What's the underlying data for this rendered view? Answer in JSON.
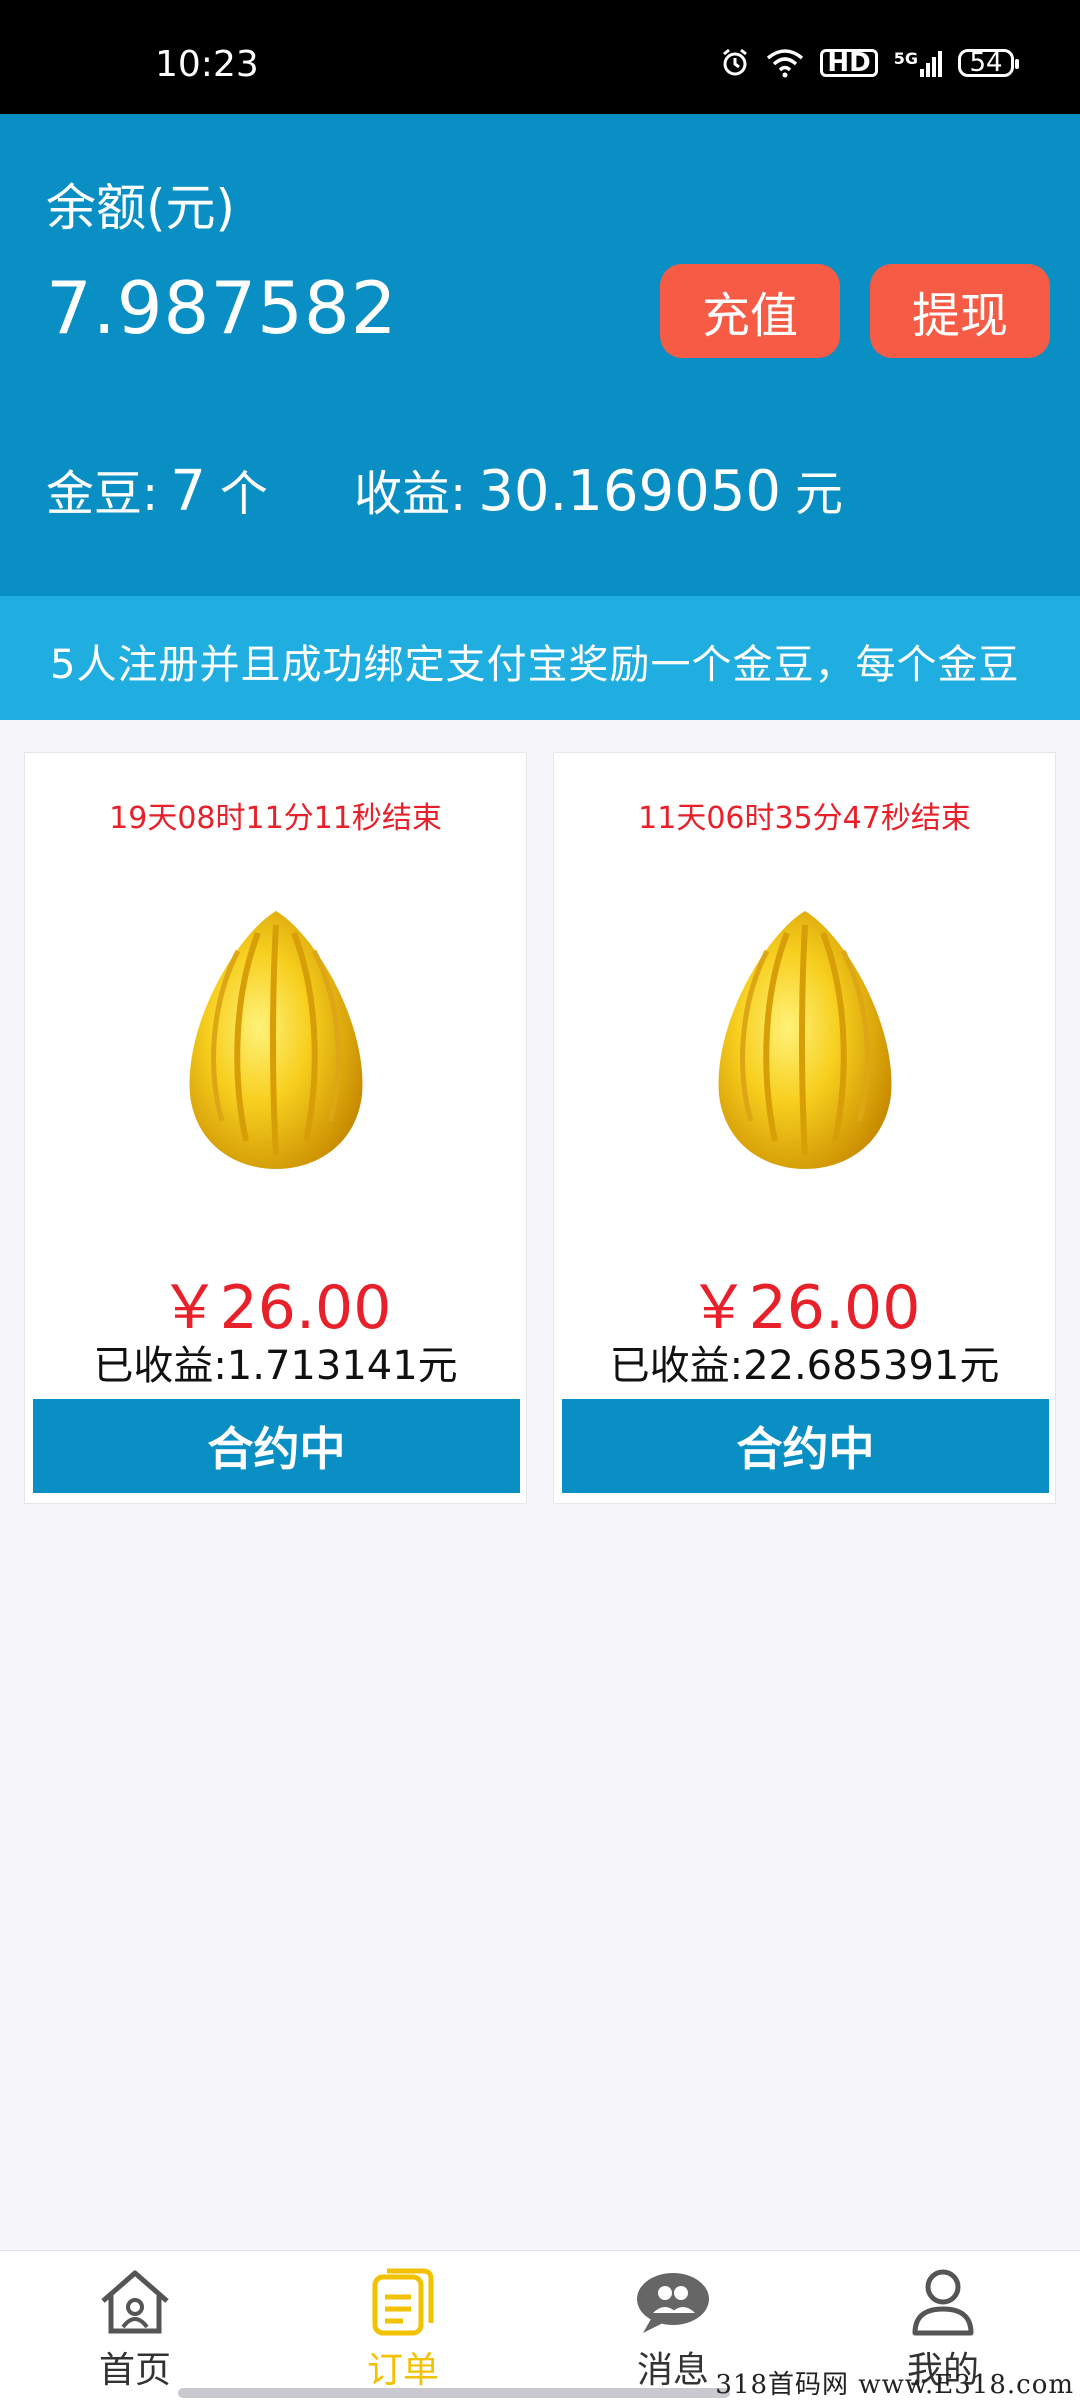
{
  "status_bar": {
    "time": "10:23",
    "icons": [
      "alarm-icon",
      "wifi-icon",
      "hd-icon",
      "signal-5g-icon"
    ],
    "hd_label": "HD",
    "net_label": "5G",
    "battery": "54"
  },
  "account": {
    "balance_label": "余额(元)",
    "balance_value": "7.987582",
    "recharge_label": "充值",
    "withdraw_label": "提现",
    "beans_label": "金豆:",
    "beans_value": "7",
    "beans_unit": "个",
    "income_label": "收益:",
    "income_value": "30.169050",
    "income_unit": "元"
  },
  "notice": {
    "text": "5人注册并且成功绑定支付宝奖励一个金豆，每个金豆"
  },
  "products": [
    {
      "countdown": "19天08时11分11秒结束",
      "price": "￥26.00",
      "earned": "已收益:1.713141元",
      "status": "合约中"
    },
    {
      "countdown": "11天06时35分47秒结束",
      "price": "￥26.00",
      "earned": "已收益:22.685391元",
      "status": "合约中"
    }
  ],
  "nav": {
    "home": "首页",
    "orders": "订单",
    "messages": "消息",
    "mine": "我的"
  },
  "watermark": "318首码网 www.E318.com",
  "colors": {
    "header_blue": "#0a8fc4",
    "notice_blue": "#20aee0",
    "action_orange": "#f65b45",
    "price_red": "#e8202a",
    "nav_active": "#f2c200"
  }
}
